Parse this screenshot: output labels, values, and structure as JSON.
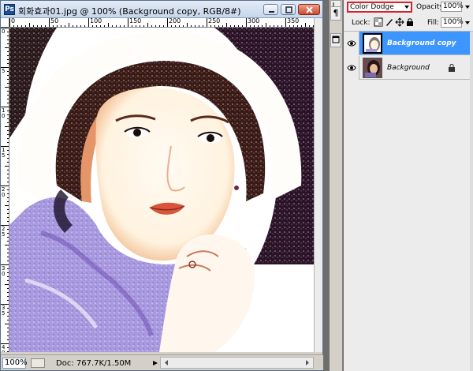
{
  "document": {
    "title": "회화효과01.jpg @ 100% (Background copy, RGB/8#)",
    "app_icon": "Ps"
  },
  "rulers": {
    "top_labels": [
      "0",
      "50",
      "100",
      "150",
      "200",
      "250",
      "300",
      "350",
      "400",
      "450"
    ],
    "left_labels": [
      "0",
      "5",
      "1 0",
      "1 5",
      "2 0",
      "2 5",
      "3 0",
      "3 5",
      "4 0"
    ]
  },
  "status": {
    "zoom": "100%",
    "doc_info": "Doc: 767.7K/1.50M"
  },
  "middle_toolbar": {
    "icons": [
      "arrow-icon",
      "paragraph-icon",
      "panel-icon"
    ],
    "paragraph_glyph": "¶"
  },
  "layers": {
    "blend_mode": "Color Dodge",
    "opacity_label": "Opacity:",
    "opacity_value": "100%",
    "lock_label": "Lock:",
    "fill_label": "Fill:",
    "fill_value": "100%",
    "items": [
      {
        "name": "Background copy",
        "visible": true,
        "selected": true
      },
      {
        "name": "Background",
        "visible": true,
        "selected": false,
        "locked": true
      }
    ]
  },
  "colors": {
    "selection": "#3d95ff",
    "blend_highlight": "#d9232a",
    "chrome": "#d4d0c8"
  }
}
